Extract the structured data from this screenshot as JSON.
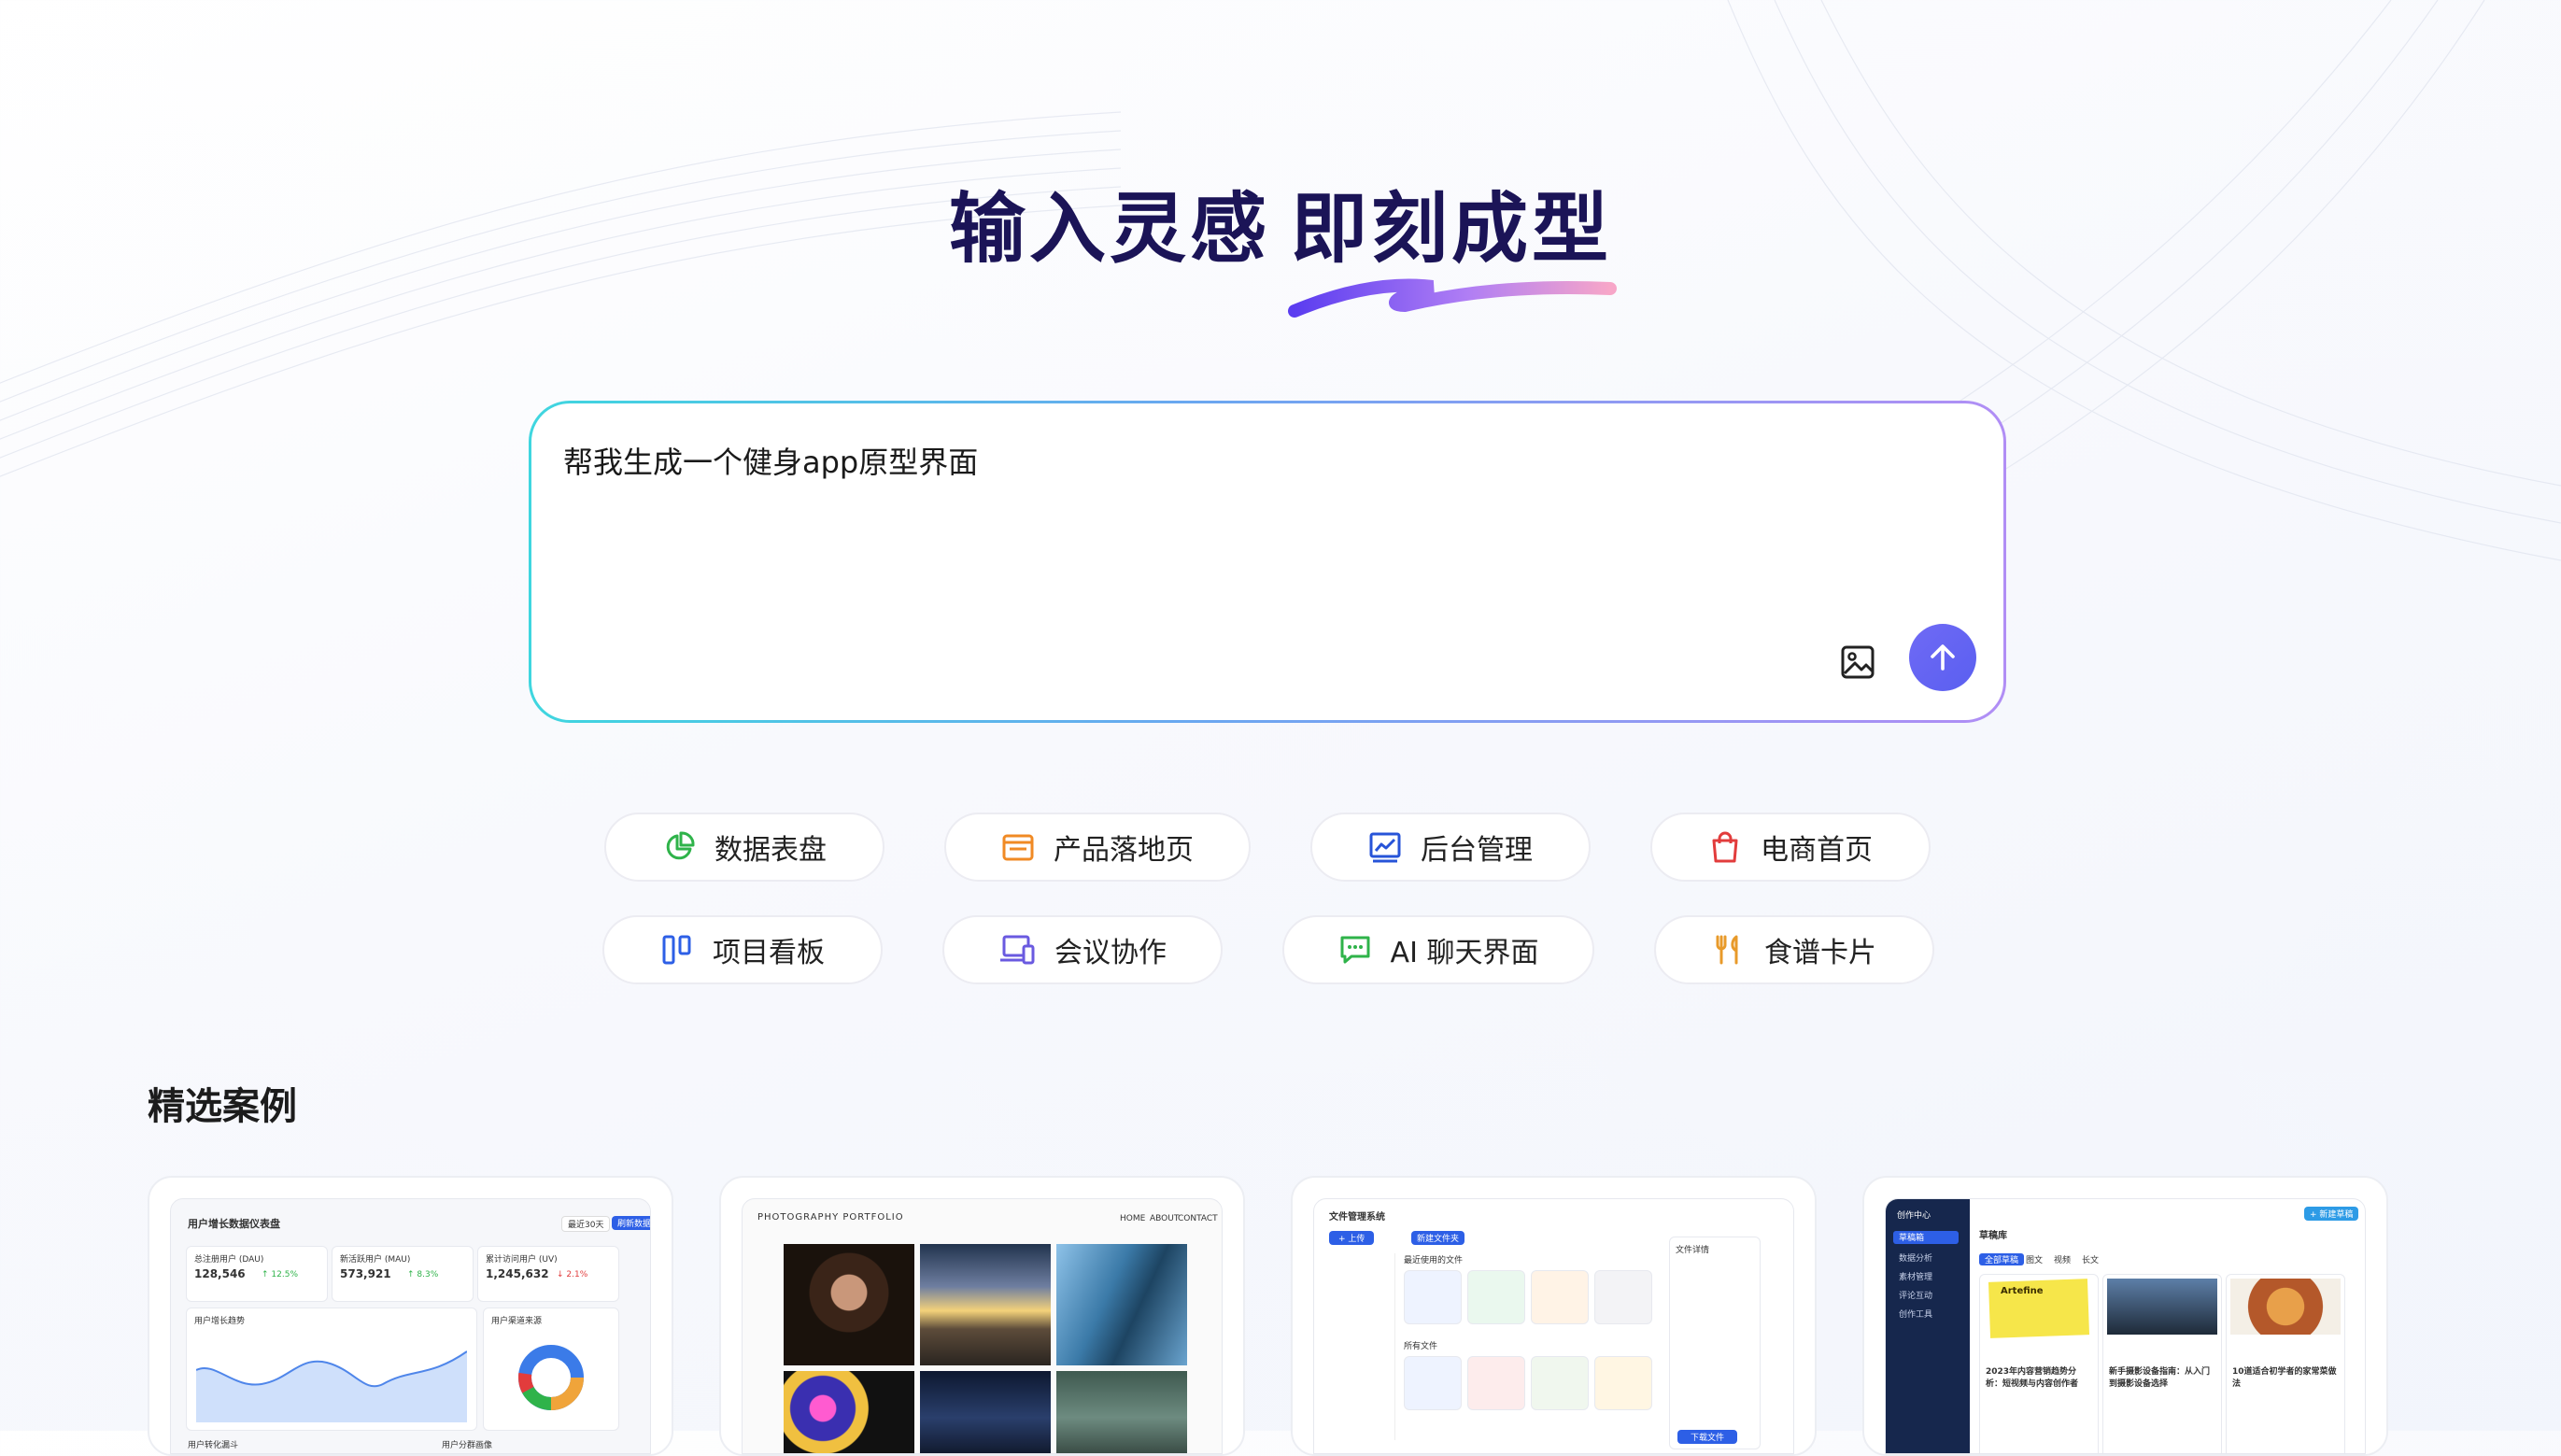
{
  "hero": {
    "title_main": "输入灵感",
    "title_highlight": "即刻成型"
  },
  "prompt": {
    "value": "帮我生成一个健身app原型界面",
    "image_icon": "image-icon",
    "send_icon": "arrow-up-icon"
  },
  "chips": [
    {
      "label": "数据表盘",
      "icon": "pie-chart-icon",
      "color": "#2fb34a"
    },
    {
      "label": "产品落地页",
      "icon": "browser-window-icon",
      "color": "#f08a24"
    },
    {
      "label": "后台管理",
      "icon": "line-chart-icon",
      "color": "#2754d8"
    },
    {
      "label": "电商首页",
      "icon": "shopping-bag-icon",
      "color": "#e23c3c"
    },
    {
      "label": "项目看板",
      "icon": "kanban-icon",
      "color": "#2d5fe6"
    },
    {
      "label": "会议协作",
      "icon": "devices-icon",
      "color": "#6a5ae0"
    },
    {
      "label": "AI 聊天界面",
      "icon": "chat-icon",
      "color": "#2fb34a"
    },
    {
      "label": "食谱卡片",
      "icon": "utensils-icon",
      "color": "#e89a2a"
    }
  ],
  "featured": {
    "title": "精选案例",
    "cards": [
      {
        "title": "用户增长数据仪表盘",
        "filter": "最近30天",
        "action": "刷新数据",
        "stats": [
          {
            "label": "总注册用户 (DAU)",
            "value": "128,546",
            "delta": "↑ 12.5%"
          },
          {
            "label": "新活跃用户 (MAU)",
            "value": "573,921",
            "delta": "↑ 8.3%"
          },
          {
            "label": "累计访问用户 (UV)",
            "value": "1,245,632",
            "delta": "↓ 2.1%"
          }
        ],
        "trend_title": "用户增长趋势",
        "source_title": "用户渠道来源",
        "bottom_left": "用户转化漏斗",
        "bottom_right": "用户分群画像"
      },
      {
        "brand": "PHOTOGRAPHY PORTFOLIO",
        "nav": [
          "HOME",
          "ABOUT",
          "CONTACT"
        ]
      },
      {
        "title": "文件管理系统",
        "upload": "+ 上传",
        "new_folder": "新建文件夹",
        "recent": "最近使用的文件",
        "all_files": "所有文件",
        "detail": "文件详情",
        "download": "下载文件"
      },
      {
        "sidebar_title": "创作中心",
        "menu": [
          "草稿箱",
          "数据分析",
          "素材管理",
          "评论互动",
          "创作工具"
        ],
        "page_title": "草稿库",
        "new_btn": "+ 新建草稿",
        "tabs": [
          "全部草稿",
          "图文",
          "视频",
          "长文"
        ],
        "note_text": "Artefine",
        "articles": [
          "2023年内容营销趋势分析：短视频与内容创作者",
          "新手摄影设备指南：从入门到摄影设备选择",
          "10道适合初学者的家常菜做法"
        ]
      }
    ]
  }
}
